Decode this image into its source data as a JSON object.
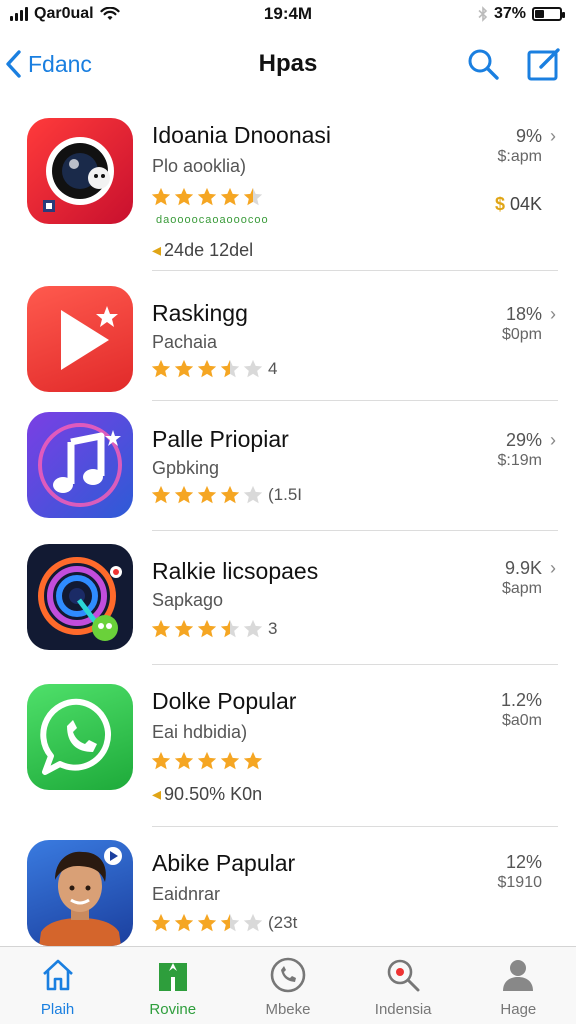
{
  "status_bar": {
    "carrier": "Qar0ual",
    "time": "19:4M",
    "battery": "37%",
    "battery_level": 0.37
  },
  "nav": {
    "back_label": "Fdanc",
    "title": "Hpas"
  },
  "apps": [
    {
      "name": "Idoania Dnoonasi",
      "subtitle": "Plo aooklia)",
      "stars": 4.5,
      "rating_text": "",
      "green_text": "daoooocaoaooocoo",
      "extra": "24de 12del",
      "extra_marker": "◂",
      "percent": "9%",
      "price": "$:apm",
      "side_price_symbol": "$",
      "side_price": "04K"
    },
    {
      "name": "Raskingg",
      "subtitle": "Pachaia",
      "stars": 3.5,
      "rating_text": "4",
      "percent": "18%",
      "price": "$0pm"
    },
    {
      "name": "Palle Priopiar",
      "subtitle": "Gpbking",
      "stars": 4,
      "rating_text": "(1.5I",
      "percent": "29%",
      "price": "$:19m"
    },
    {
      "name": "Ralkie licsopaes",
      "subtitle": "Sapkago",
      "stars": 3.5,
      "rating_text": "3",
      "percent": "9.9K",
      "price": "$apm"
    },
    {
      "name": "Dolke Popular",
      "subtitle": "Eai hdbidia)",
      "stars": 5,
      "rating_text": "",
      "extra": "90.50% K0n",
      "extra_marker": "◂",
      "percent": "1.2%",
      "price": "$a0m"
    },
    {
      "name": "Abike Papular",
      "subtitle": "Eaidnrar",
      "stars": 3.5,
      "rating_text": "(23t",
      "percent": "12%",
      "price": "$1910"
    }
  ],
  "tabs": [
    {
      "label": "Plaih",
      "icon": "home-icon",
      "state": "active-blue"
    },
    {
      "label": "Rovine",
      "icon": "bookmark-icon",
      "state": "active-green"
    },
    {
      "label": "Mbeke",
      "icon": "phone-icon",
      "state": ""
    },
    {
      "label": "Indensia",
      "icon": "search-icon",
      "state": ""
    },
    {
      "label": "Hage",
      "icon": "person-icon",
      "state": ""
    }
  ],
  "colors": {
    "accent_blue": "#1a7fe0",
    "star": "#f5a623",
    "active_green": "#2e9e3c"
  }
}
